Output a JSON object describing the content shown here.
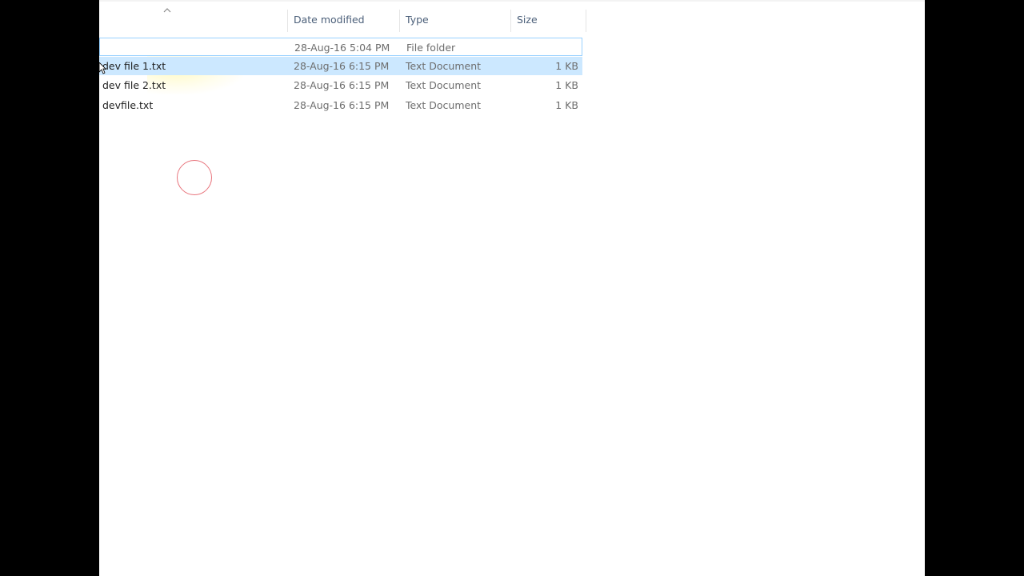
{
  "columns": {
    "date_modified": "Date modified",
    "type": "Type",
    "size": "Size"
  },
  "rows": [
    {
      "name": "",
      "date": "28-Aug-16 5:04 PM",
      "type": "File folder",
      "size": ""
    },
    {
      "name": "dev file 1.txt",
      "date": "28-Aug-16 6:15 PM",
      "type": "Text Document",
      "size": "1 KB"
    },
    {
      "name": "dev file 2.txt",
      "date": "28-Aug-16 6:15 PM",
      "type": "Text Document",
      "size": "1 KB"
    },
    {
      "name": "devfile.txt",
      "date": "28-Aug-16 6:15 PM",
      "type": "Text Document",
      "size": "1 KB"
    }
  ],
  "colors": {
    "selection": "#cce8ff",
    "focus_border": "#99d1ff",
    "header_text": "#4c607a",
    "click_ring": "#e8747c"
  },
  "icons": {
    "sort": "sort-ascending-icon",
    "cursor": "mouse-pointer-icon"
  }
}
